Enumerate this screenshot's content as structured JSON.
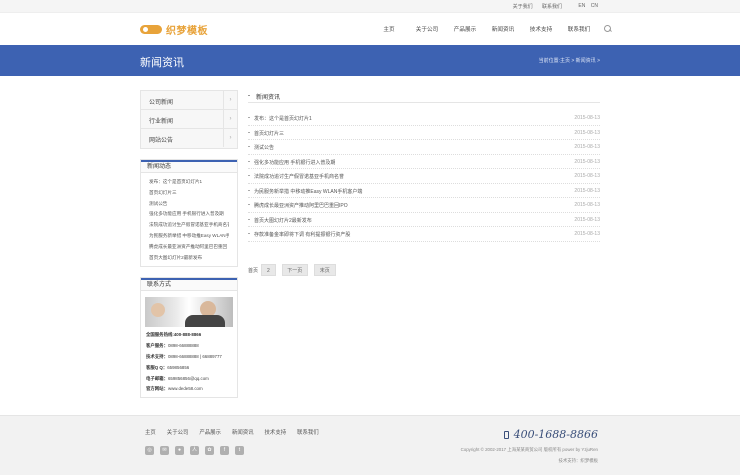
{
  "topbar": {
    "links": [
      "关于我们",
      "联系我们"
    ],
    "lang": [
      "EN",
      "CN"
    ]
  },
  "header": {
    "logo_text": "织梦模板",
    "nav": [
      "主页",
      "关于公司",
      "产品展示",
      "新闻资讯",
      "技术支持",
      "联系我们"
    ],
    "search_icon": "search-icon"
  },
  "banner": {
    "title": "新闻资讯",
    "breadcrumb": "当前位置:主页 > 新闻资讯 >"
  },
  "sidebar": {
    "categories": [
      {
        "label": "公司新闻",
        "arrow": "›"
      },
      {
        "label": "行业新闻",
        "arrow": "›"
      },
      {
        "label": "网站公告",
        "arrow": "›"
      }
    ],
    "news_title": "新闻动态",
    "news": [
      "发布：这个是首页幻灯片1",
      "首页幻灯片三",
      "测试公告",
      "强化多功能应用 手机银行进入普及期",
      "法院成功追讨生产假冒诺基亚手机商名誉",
      "为民服务新举措 中移动推Easy WLAN手",
      "腾虎成长最亚洲资产推动阿里巴巴重回",
      "首页大图幻灯片2最新发布"
    ],
    "contact_title": "联系方式",
    "contact": [
      {
        "label": "全国服务热线:",
        "value": "400-888-8866"
      },
      {
        "label": "客户服务：",
        "value": "0898-66888888"
      },
      {
        "label": "技术支持：",
        "value": "0898-66888888 | 66889777"
      },
      {
        "label": "客服Q Q：",
        "value": "659856856"
      },
      {
        "label": "电子邮箱：",
        "value": "659856856@qq.com"
      },
      {
        "label": "官方网站：",
        "value": "www.dede58.com"
      }
    ]
  },
  "main": {
    "heading": "新闻资讯",
    "articles": [
      {
        "title": "发布：这个是首页幻灯片1",
        "date": "2015-08-13"
      },
      {
        "title": "首页幻灯片三",
        "date": "2015-08-13"
      },
      {
        "title": "测试公告",
        "date": "2015-08-13"
      },
      {
        "title": "强化多功能应用 手机银行进入普及期",
        "date": "2015-08-13"
      },
      {
        "title": "法院成功追讨生产假冒诺基亚手机商名誉",
        "date": "2015-08-13"
      },
      {
        "title": "为民服务新举措 中移动推Easy WLAN手机客户端",
        "date": "2015-08-13"
      },
      {
        "title": "腾虎成长最亚洲资产推动阿里巴巴重回IPO",
        "date": "2015-08-13"
      },
      {
        "title": "首页大图幻灯片2最新发布",
        "date": "2015-08-13"
      },
      {
        "title": "存款准备金率即将下调 有利提振银行资产股",
        "date": "2015-08-13"
      }
    ],
    "pager": {
      "first_label": "首页",
      "page": "2",
      "next": "下一页",
      "last": "末页"
    }
  },
  "footer": {
    "nav": [
      "主页",
      "关于公司",
      "产品展示",
      "新闻资讯",
      "技术支持",
      "联系我们"
    ],
    "social_icons": [
      "weibo-icon",
      "wechat-icon",
      "qq-icon",
      "renren-icon",
      "douban-icon",
      "facebook-icon",
      "twitter-icon"
    ],
    "social_glyphs": [
      "◎",
      "✉",
      "●",
      "人",
      "✿",
      "f",
      "t"
    ],
    "phone": "400-1688-8866",
    "copyright": "Copyright © 2002-2017 上海某某商贸公司 版权所有 power by YzjuRen",
    "tech": "技术支持：织梦模板"
  }
}
